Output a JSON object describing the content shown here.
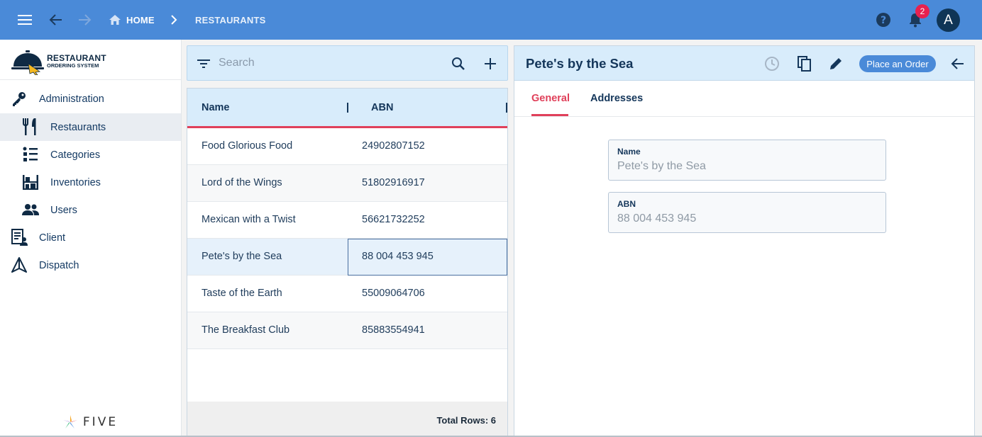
{
  "header": {
    "breadcrumb_home": "HOME",
    "breadcrumb_current": "RESTAURANTS",
    "notification_count": "2",
    "avatar_initial": "A"
  },
  "sidebar": {
    "logo_title": "RESTAURANT",
    "logo_subtitle": "ORDERING SYSTEM",
    "items": [
      {
        "label": "Administration",
        "icon": "key-icon"
      },
      {
        "label": "Restaurants",
        "icon": "fork-knife-icon",
        "active": true
      },
      {
        "label": "Categories",
        "icon": "list-icon"
      },
      {
        "label": "Inventories",
        "icon": "shelves-icon"
      },
      {
        "label": "Users",
        "icon": "users-icon"
      },
      {
        "label": "Client",
        "icon": "client-form-icon"
      },
      {
        "label": "Dispatch",
        "icon": "dispatch-icon"
      }
    ],
    "footer_brand": "FIVE"
  },
  "list": {
    "search_placeholder": "Search",
    "columns": [
      "Name",
      "ABN"
    ],
    "rows": [
      {
        "name": "Food Glorious Food",
        "abn": "24902807152"
      },
      {
        "name": "Lord of the Wings",
        "abn": "51802916917"
      },
      {
        "name": "Mexican with a Twist",
        "abn": "56621732252"
      },
      {
        "name": "Pete's by the Sea",
        "abn": "88 004 453 945",
        "selected": true
      },
      {
        "name": "Taste of the Earth",
        "abn": "55009064706"
      },
      {
        "name": "The Breakfast Club",
        "abn": "85883554941"
      }
    ],
    "total_rows": "Total Rows: 6"
  },
  "detail": {
    "title": "Pete's by the Sea",
    "place_order_label": "Place an Order",
    "tabs": [
      "General",
      "Addresses"
    ],
    "fields": [
      {
        "label": "Name",
        "value": "Pete's by the Sea"
      },
      {
        "label": "ABN",
        "value": "88 004 453 945"
      }
    ]
  },
  "colors": {
    "header_blue": "#4a8ad8",
    "panel_blue": "#d8ecfb",
    "accent_red": "#e0405a",
    "badge_red": "#e8214f",
    "navy": "#14365a"
  }
}
